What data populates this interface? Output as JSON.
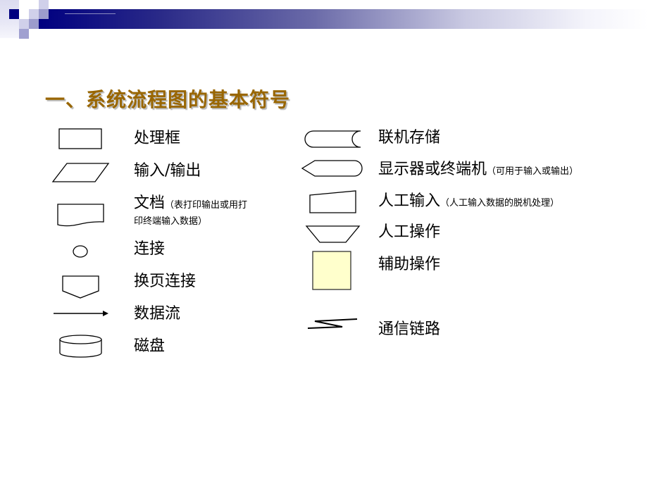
{
  "slide": {
    "title": "一、系统流程图的基本符号",
    "colors": {
      "title": "#996600",
      "header_dark": "#000080",
      "auxiliary_fill": "#FFFFCC",
      "stroke": "#000000"
    }
  },
  "symbols_left": [
    {
      "id": "process",
      "label": "处理框",
      "icon": "rectangle-icon"
    },
    {
      "id": "io",
      "label": "输入/输出",
      "icon": "parallelogram-icon"
    },
    {
      "id": "document",
      "label": "文档",
      "note_line1": "（表打印输出或用打",
      "note_line2": "印终端输入数据）",
      "icon": "document-icon"
    },
    {
      "id": "connector",
      "label": "连接",
      "icon": "circle-icon"
    },
    {
      "id": "offpage",
      "label": "换页连接",
      "icon": "offpage-connector-icon"
    },
    {
      "id": "dataflow",
      "label": "数据流",
      "icon": "arrow-icon"
    },
    {
      "id": "disk",
      "label": "磁盘",
      "icon": "cylinder-icon"
    }
  ],
  "symbols_right": [
    {
      "id": "online_storage",
      "label": "联机存储",
      "icon": "online-storage-icon"
    },
    {
      "id": "display",
      "label": "显示器或终端机",
      "note": "（可用于输入或输出）",
      "icon": "display-icon"
    },
    {
      "id": "manual_input",
      "label": "人工输入",
      "note": "（人工输入数据的脱机处理）",
      "icon": "manual-input-icon"
    },
    {
      "id": "manual_op",
      "label": "人工操作",
      "icon": "trapezoid-icon"
    },
    {
      "id": "auxiliary_op",
      "label": "辅助操作",
      "icon": "square-icon"
    },
    {
      "id": "comm_link",
      "label": "通信链路",
      "icon": "zigzag-icon"
    }
  ]
}
